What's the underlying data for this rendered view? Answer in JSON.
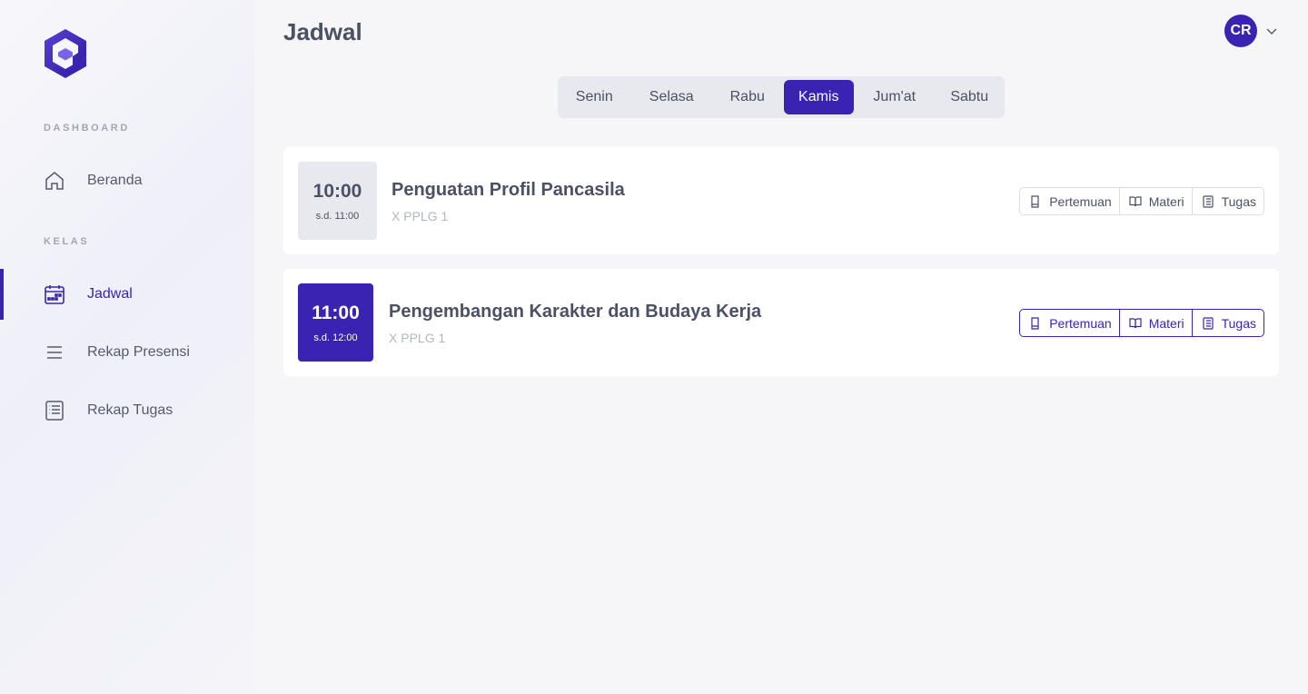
{
  "sidebar": {
    "sections": [
      {
        "label": "DASHBOARD"
      },
      {
        "label": "KELAS"
      }
    ],
    "items": [
      {
        "label": "Beranda",
        "icon": "home-icon"
      },
      {
        "label": "Jadwal",
        "icon": "calendar-icon",
        "active": true
      },
      {
        "label": "Rekap Presensi",
        "icon": "list-icon"
      },
      {
        "label": "Rekap Tugas",
        "icon": "document-list-icon"
      }
    ]
  },
  "header": {
    "title": "Jadwal",
    "avatar_initials": "CR"
  },
  "tabs": [
    {
      "label": "Senin"
    },
    {
      "label": "Selasa"
    },
    {
      "label": "Rabu"
    },
    {
      "label": "Kamis",
      "active": true
    },
    {
      "label": "Jum'at"
    },
    {
      "label": "Sabtu"
    }
  ],
  "schedule": [
    {
      "start": "10:00",
      "end": "s.d. 11:00",
      "subject": "Penguatan Profil Pancasila",
      "class": "X PPLG 1",
      "actions": [
        "Pertemuan",
        "Materi",
        "Tugas"
      ]
    },
    {
      "start": "11:00",
      "end": "s.d. 12:00",
      "subject": "Pengembangan Karakter dan Budaya Kerja",
      "class": "X PPLG 1",
      "actions": [
        "Pertemuan",
        "Materi",
        "Tugas"
      ]
    }
  ],
  "colors": {
    "accent": "#3a23b3",
    "muted_box": "#e8e9ee",
    "background": "#f6f6f9"
  }
}
